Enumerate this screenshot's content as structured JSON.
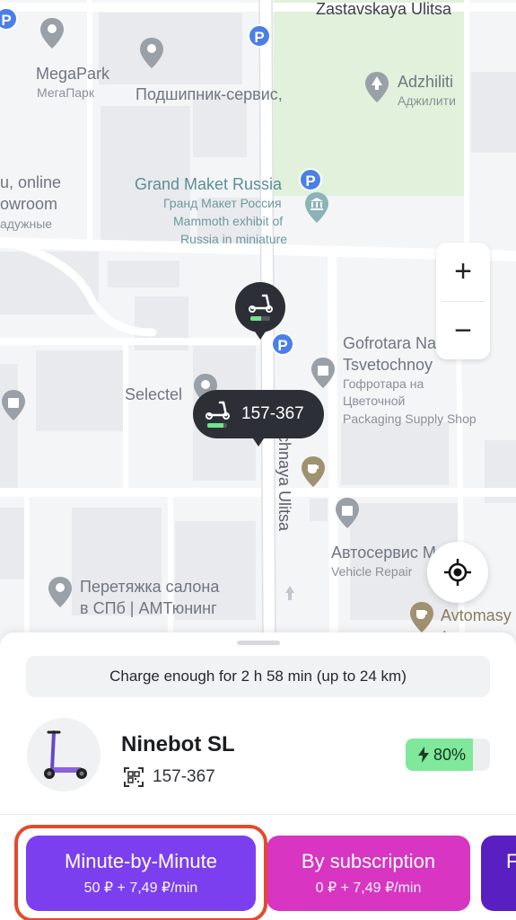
{
  "map": {
    "streets": {
      "top": "Zastavskaya Ulitsa",
      "vertical": "Lotochnaya Ulitsa",
      "vertical_visible": "tochnaya Ulitsa"
    },
    "pois": {
      "megapark_en": "MegaPark",
      "megapark_ru": "МегаПарк",
      "podshipnik": "Подшипник-сервис,",
      "adzhiliti_en": "Adzhiliti",
      "adzhiliti_ru": "Аджилити",
      "showroom_1": "u, online",
      "showroom_2": "owroom",
      "showroom_3": "адужные",
      "grand_maket_en": "Grand Maket Russia",
      "grand_maket_ru": "Гранд Макет Россия",
      "grand_maket_desc1": "Mammoth exhibit of",
      "grand_maket_desc2": "Russia in miniature",
      "gofrotara_1": "Gofrotara Na",
      "gofrotara_2": "Tsvetochnoy",
      "gofrotara_ru1": "Гофротара на",
      "gofrotara_ru2": "Цветочной",
      "gofrotara_desc": "Packaging Supply Shop",
      "selectel": "Selectel",
      "avtoservis_ru": "Автосервис ",
      "avtoservis_en": "Mobil",
      "avtoservis_desc": "Vehicle Repair",
      "peretyazhka_1": "Перетяжка салона",
      "peretyazhka_2": "в СПб | АМТюнинг",
      "avtomasy_en": "Avtomasy",
      "avtomasy_ru": "Автомася"
    },
    "parking_label": "P",
    "zoom_in": "+",
    "zoom_out": "−",
    "scooter_marker_code": "157-367"
  },
  "sheet": {
    "charge_info": "Charge enough for 2 h 58 min (up to 24 km)",
    "model": "Ninebot SL",
    "scooter_id": "157-367",
    "battery_label": "80%",
    "battery_level": 0.8,
    "tariffs": [
      {
        "title": "Minute-by-Minute",
        "price": "50 ₽ + 7,49 ₽/min",
        "color": "#7b3ff0",
        "selected": true
      },
      {
        "title": "By subscription",
        "price": "0 ₽ + 7,49 ₽/min",
        "color": "#d735c2",
        "selected": false
      },
      {
        "title": "F",
        "price": "",
        "color": "#5a1fc0",
        "selected": false
      }
    ]
  },
  "colors": {
    "accent_purple": "#7b3ff0",
    "accent_pink": "#d735c2",
    "battery_green": "#7fe89a",
    "highlight_red": "#e34a2f",
    "parking_blue": "#4b7fe8"
  }
}
